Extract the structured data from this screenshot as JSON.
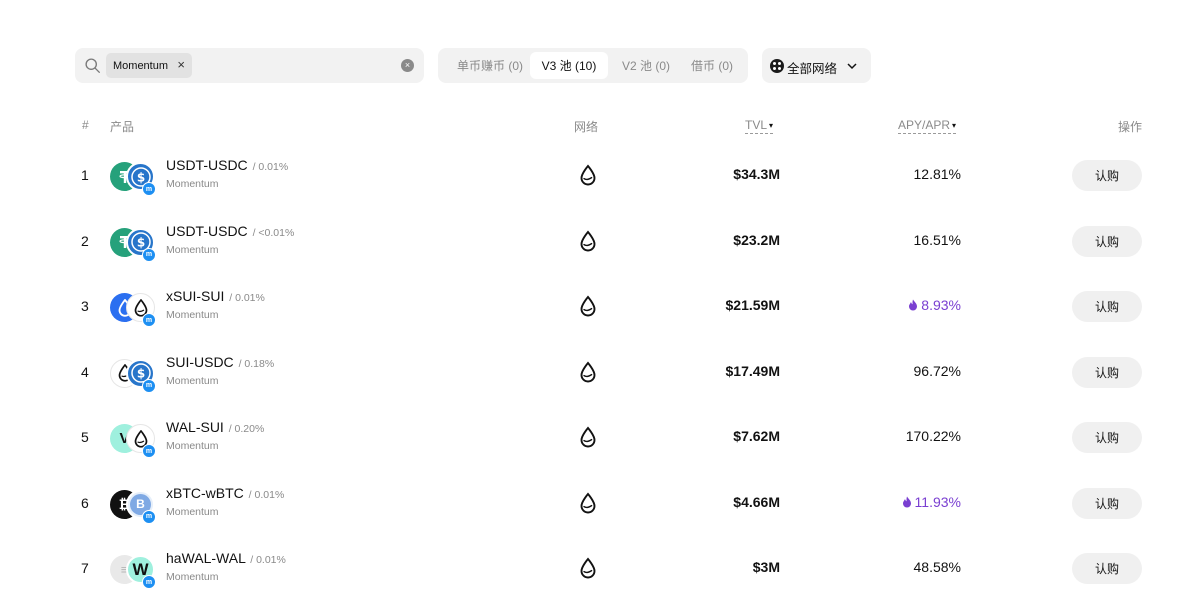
{
  "search": {
    "chip_label": "Momentum",
    "chip_remove": "×",
    "clear": "×",
    "search_icon": "search-icon"
  },
  "tabs": [
    {
      "label": "单币赚币 (0)",
      "active": false
    },
    {
      "label": "V3 池 (10)",
      "active": true
    },
    {
      "label": "V2 池 (0)",
      "active": false
    },
    {
      "label": "借币 (0)",
      "active": false
    }
  ],
  "network_filter": {
    "label": "全部网络",
    "icon": "grid-dots-icon",
    "chevron": "chevron-down-icon"
  },
  "table": {
    "headers": {
      "rank": "#",
      "product": "产品",
      "network": "网络",
      "tvl": "TVL",
      "apy": "APY/APR",
      "action": "操作"
    },
    "sort_indicator": "▾",
    "rows": [
      {
        "rank": "1",
        "pair": "USDT-USDC",
        "fee": "/ 0.01%",
        "protocol": "Momentum",
        "tvl": "$34.3M",
        "apy": "12.81%",
        "boost": false,
        "action": "认购",
        "coins": [
          "usdt",
          "usdc"
        ]
      },
      {
        "rank": "2",
        "pair": "USDT-USDC",
        "fee": "/ <0.01%",
        "protocol": "Momentum",
        "tvl": "$23.2M",
        "apy": "16.51%",
        "boost": false,
        "action": "认购",
        "coins": [
          "usdt",
          "usdc"
        ]
      },
      {
        "rank": "3",
        "pair": "xSUI-SUI",
        "fee": "/ 0.01%",
        "protocol": "Momentum",
        "tvl": "$21.59M",
        "apy": "8.93%",
        "boost": true,
        "action": "认购",
        "coins": [
          "xsui",
          "sui"
        ]
      },
      {
        "rank": "4",
        "pair": "SUI-USDC",
        "fee": "/ 0.18%",
        "protocol": "Momentum",
        "tvl": "$17.49M",
        "apy": "96.72%",
        "boost": false,
        "action": "认购",
        "coins": [
          "sui",
          "usdc"
        ]
      },
      {
        "rank": "5",
        "pair": "WAL-SUI",
        "fee": "/ 0.20%",
        "protocol": "Momentum",
        "tvl": "$7.62M",
        "apy": "170.22%",
        "boost": false,
        "action": "认购",
        "coins": [
          "wal",
          "sui"
        ]
      },
      {
        "rank": "6",
        "pair": "xBTC-wBTC",
        "fee": "/ 0.01%",
        "protocol": "Momentum",
        "tvl": "$4.66M",
        "apy": "11.93%",
        "boost": true,
        "action": "认购",
        "coins": [
          "xbtc",
          "wbtc"
        ]
      },
      {
        "rank": "7",
        "pair": "haWAL-WAL",
        "fee": "/ 0.01%",
        "protocol": "Momentum",
        "tvl": "$3M",
        "apy": "48.58%",
        "boost": false,
        "action": "认购",
        "coins": [
          "hawal",
          "wal"
        ]
      }
    ]
  },
  "colors": {
    "boost_apy": "#7a3fd1",
    "usdt": "#26a17b",
    "usdc": "#2775ca",
    "sui": "#ffffff",
    "protocol_badge": "#1d8ff2"
  }
}
